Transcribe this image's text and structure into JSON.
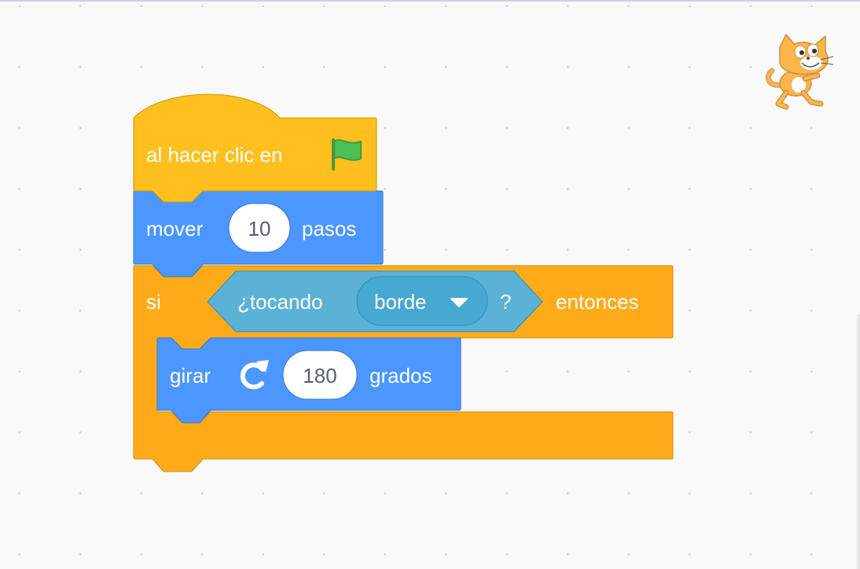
{
  "workspace": {
    "blocks": {
      "event_when_flag": {
        "label": "al hacer clic en",
        "icon": "green-flag-icon"
      },
      "motion_move": {
        "label_before": "mover",
        "steps": "10",
        "label_after": "pasos"
      },
      "control_if": {
        "label_if": "si",
        "condition": {
          "label": "¿tocando",
          "menu_value": "borde",
          "question_mark": "?"
        },
        "label_then": "entonces"
      },
      "motion_turn": {
        "label_before": "girar",
        "icon": "rotate-clockwise-icon",
        "degrees": "180",
        "label_after": "grados"
      }
    },
    "sprite_icon": "scratch-cat-sprite"
  },
  "colors": {
    "events": "#ffbf1e",
    "motion": "#4c97ff",
    "control": "#ffab19",
    "sensing": "#5cb1d6",
    "sensing_dropdown": "#47a8d1",
    "workspace_bg": "#f9f9f9"
  }
}
